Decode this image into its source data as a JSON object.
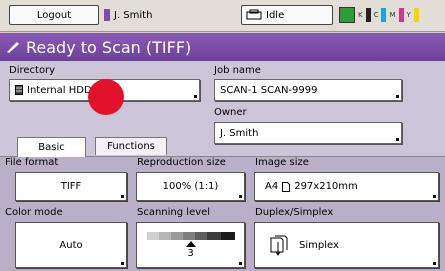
{
  "topbar": {
    "logout_label": "Logout",
    "user_name": "J. Smith",
    "status_label": "Idle",
    "toner_labels": [
      "K",
      "C",
      "M",
      "Y"
    ]
  },
  "title": "Ready to Scan (TIFF)",
  "directory": {
    "label": "Directory",
    "value": "Internal HDD"
  },
  "job_name": {
    "label": "Job name",
    "value": "SCAN-1 SCAN-9999"
  },
  "owner": {
    "label": "Owner",
    "value": "J. Smith"
  },
  "tabs": [
    {
      "label": "Basic"
    },
    {
      "label": "Functions"
    }
  ],
  "settings": {
    "file_format": {
      "label": "File format",
      "value": "TIFF"
    },
    "reproduction_size": {
      "label": "Reproduction size",
      "value": "100% (1:1)"
    },
    "image_size": {
      "label": "Image size",
      "value": "A4",
      "dims": "297x210mm"
    },
    "color_mode": {
      "label": "Color mode",
      "value": "Auto"
    },
    "scanning_level": {
      "label": "Scanning level",
      "value": "3"
    },
    "duplex_simplex": {
      "label": "Duplex/Simplex",
      "value": "Simplex"
    }
  }
}
